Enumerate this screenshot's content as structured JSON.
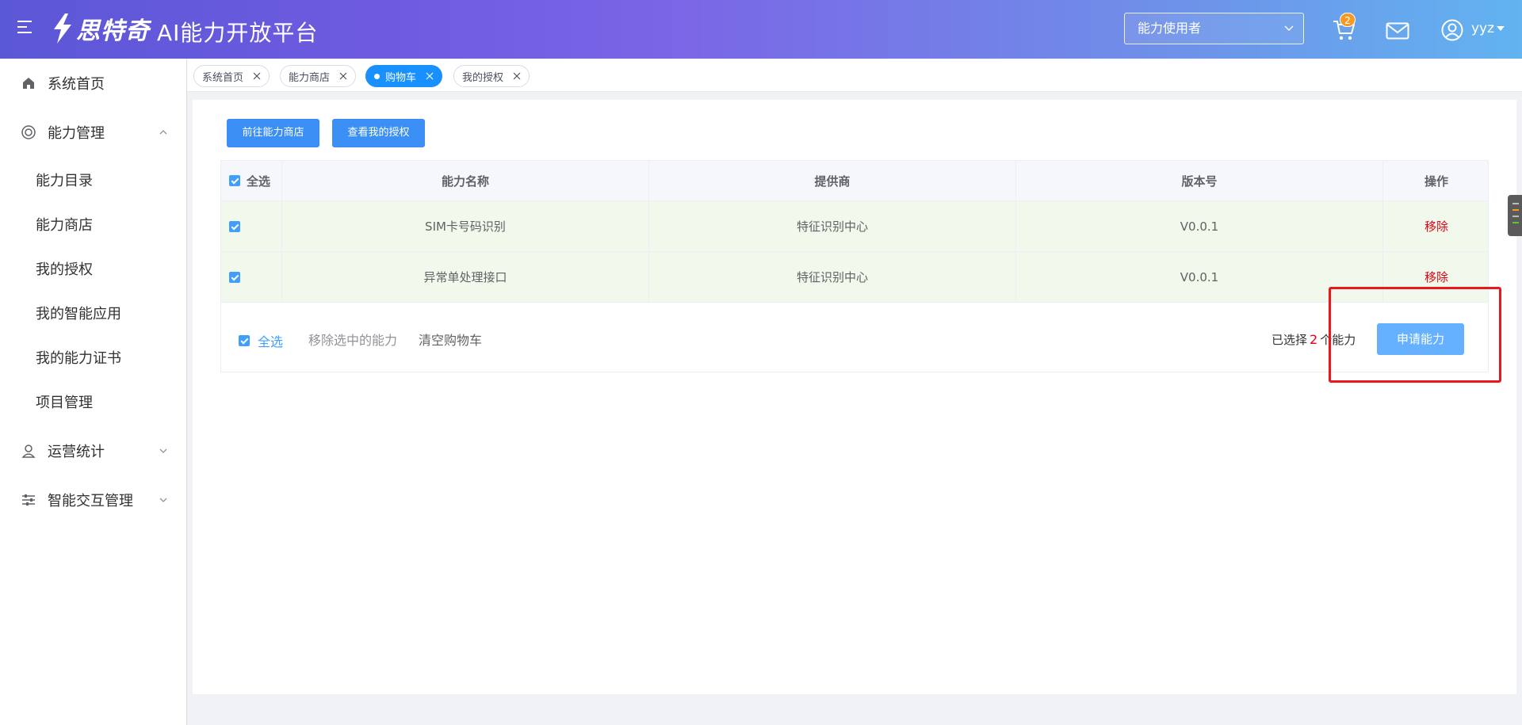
{
  "header": {
    "logo_text": "思特奇",
    "platform_title": "AI能力开放平台",
    "role_select": {
      "value": "能力使用者"
    },
    "cart_badge": "2",
    "user_name": "yyz",
    "gradient_start": "#5b58d6",
    "gradient_end": "#62b3f0"
  },
  "sidebar": {
    "items": [
      {
        "label": "系统首页",
        "icon": "home-icon"
      },
      {
        "label": "能力管理",
        "icon": "ring-icon",
        "expanded": true,
        "children": [
          "能力目录",
          "能力商店",
          "我的授权",
          "我的智能应用",
          "我的能力证书",
          "项目管理"
        ]
      },
      {
        "label": "运营统计",
        "icon": "user-stats-icon",
        "expanded": false
      },
      {
        "label": "智能交互管理",
        "icon": "sliders-icon",
        "expanded": false
      }
    ]
  },
  "tabs": [
    {
      "label": "系统首页",
      "active": false
    },
    {
      "label": "能力商店",
      "active": false
    },
    {
      "label": "购物车",
      "active": true
    },
    {
      "label": "我的授权",
      "active": false
    }
  ],
  "actions": {
    "go_store": "前往能力商店",
    "view_auth": "查看我的授权"
  },
  "table": {
    "select_all": "全选",
    "columns": [
      "能力名称",
      "提供商",
      "版本号",
      "操作"
    ],
    "rows": [
      {
        "name": "SIM卡号码识别",
        "provider": "特征识别中心",
        "version": "V0.0.1",
        "action": "移除",
        "checked": true
      },
      {
        "name": "异常单处理接口",
        "provider": "特征识别中心",
        "version": "V0.0.1",
        "action": "移除",
        "checked": true
      }
    ]
  },
  "footer": {
    "select_all": "全选",
    "remove_selected": "移除选中的能力",
    "clear_cart": "清空购物车",
    "selected_prefix": "已选择",
    "selected_count": "2",
    "selected_suffix": "个能力",
    "apply_button": "申请能力"
  },
  "colors": {
    "primary": "#409eff",
    "danger": "#e60012",
    "row_selected_bg": "#f0f9eb",
    "annotation_box": "#e8181c"
  }
}
